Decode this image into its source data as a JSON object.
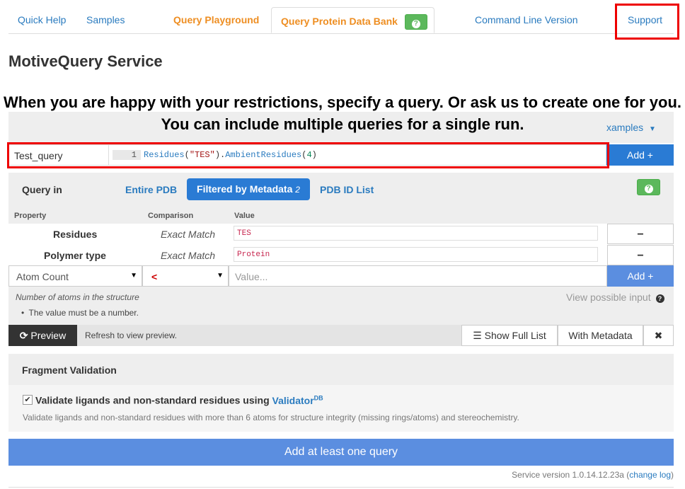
{
  "nav": {
    "quick_help": "Quick Help",
    "samples": "Samples",
    "query_playground": "Query Playground",
    "query_pdb": "Query Protein Data Bank",
    "query_pdb_badge": "?",
    "cli": "Command Line Version",
    "support": "Support"
  },
  "page_title": "MotiveQuery Service",
  "annotation": "When you are happy with your restrictions, specify a query. Or ask us to create one for you. You can include multiple queries for a single run.",
  "examples_link": "xamples",
  "query": {
    "name": "Test_query",
    "line_number": "1",
    "code_fn": "Residues",
    "code_arg": "\"TES\"",
    "code_method": "AmbientResidues",
    "code_num": "4",
    "add_label": "Add +"
  },
  "query_in": {
    "label": "Query in",
    "tabs": [
      "Entire PDB",
      "Filtered by Metadata",
      "PDB ID List"
    ],
    "filter_count": "2",
    "help_badge": "?"
  },
  "filters": {
    "headers": [
      "Property",
      "Comparison",
      "Value"
    ],
    "rows": [
      {
        "property": "Residues",
        "comparison": "Exact Match",
        "value": "TES",
        "remove": "−"
      },
      {
        "property": "Polymer type",
        "comparison": "Exact Match",
        "value": "Protein",
        "remove": "−"
      }
    ],
    "new_row": {
      "property": "Atom Count",
      "comparison": "<",
      "value_placeholder": "Value...",
      "add_label": "Add +"
    },
    "description": "Number of atoms in the structure",
    "view_possible": "View possible input",
    "note": "The value must be a number."
  },
  "preview": {
    "button": "Preview",
    "refresh_text": "Refresh to view preview.",
    "show_full_list": "Show Full List",
    "with_metadata": "With Metadata",
    "close": "✖"
  },
  "validation": {
    "title": "Fragment Validation",
    "checkbox_label": "Validate ligands and non-standard residues using",
    "validator_link": "Validator",
    "validator_sup": "DB",
    "checked": true,
    "description": "Validate ligands and non-standard residues with more than 6 atoms for structure integrity (missing rings/atoms) and stereochemistry."
  },
  "submit_label": "Add at least one query",
  "footer": {
    "version": "Service version 1.0.14.12.23a (",
    "change_log": "change log",
    "close_paren": ")"
  },
  "colors": {
    "accent_blue": "#2a7bd4",
    "orange": "#ee8e22",
    "green": "#5cb85c",
    "highlight_red": "#ee0000"
  }
}
